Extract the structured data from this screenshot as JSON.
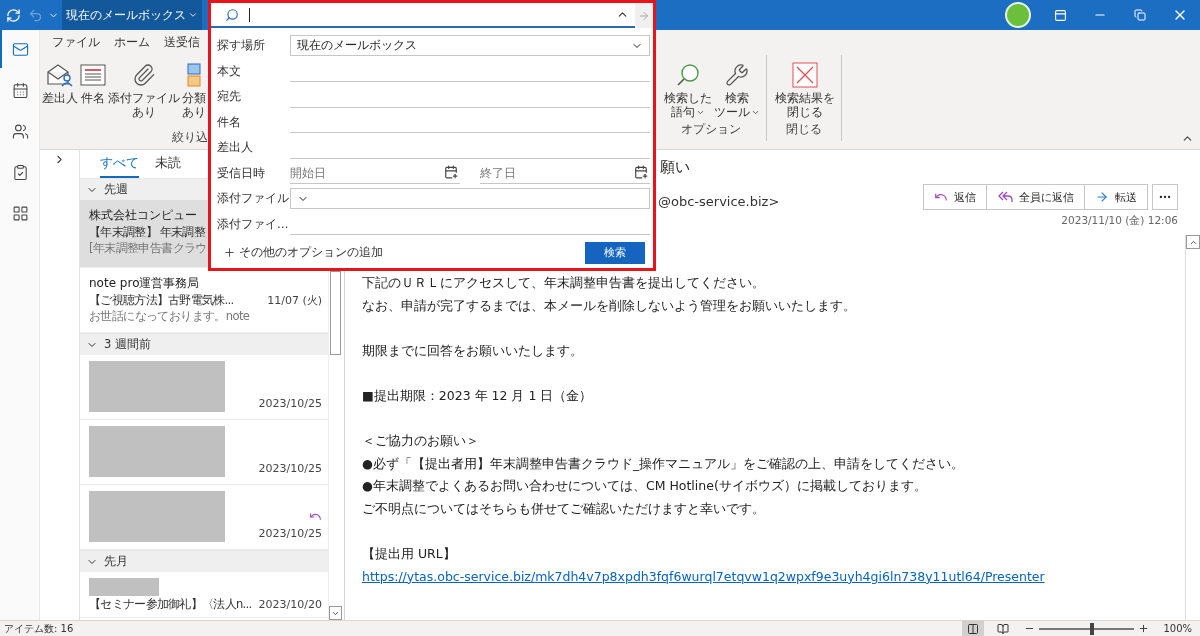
{
  "title_bar": {
    "undo": {
      "disabled": true
    },
    "mailbox_selector": "現在のメールボックス"
  },
  "nav_rail": [
    {
      "selected": true
    },
    {
      "selected": false
    },
    {
      "selected": false
    },
    {
      "selected": false
    },
    {
      "selected": false
    }
  ],
  "ribbon": {
    "tabs": [
      "ファイル",
      "ホーム",
      "送受信"
    ],
    "left_group": {
      "label": "絞り込",
      "buttons": [
        {
          "kind": "sender",
          "lines": [
            "差出人"
          ]
        },
        {
          "kind": "subject",
          "lines": [
            "件名"
          ]
        },
        {
          "kind": "attachment",
          "lines": [
            "添付ファイル",
            "あり"
          ]
        },
        {
          "kind": "category",
          "lines": [
            "分類",
            "あり"
          ]
        }
      ]
    },
    "right_groups": [
      {
        "label": "オプション",
        "buttons": [
          {
            "kind": "recent",
            "lines": [
              "検索した",
              "語句"
            ],
            "has_menu": true
          },
          {
            "kind": "tools",
            "lines": [
              "検索",
              "ツール"
            ],
            "has_menu": true
          }
        ]
      },
      {
        "label": "閉じる",
        "buttons": [
          {
            "kind": "close",
            "lines": [
              "検索結果を",
              "閉じる"
            ],
            "has_menu": false
          }
        ]
      }
    ]
  },
  "message_list": {
    "tabs": [
      {
        "label": "すべて",
        "selected": true
      },
      {
        "label": "未読",
        "selected": false
      }
    ],
    "groups": [
      {
        "label": "先週",
        "expanded": true,
        "items": [
          {
            "kind": "message",
            "selected": true,
            "replied": false,
            "sender": "株式会社コンピュー",
            "subject": "【年末調整】 年末調整",
            "preview": "[年末調整申告書クラウ"
          },
          {
            "kind": "message",
            "selected": false,
            "replied": false,
            "sender": "note pro運営事務局",
            "subject": "【ご視聴方法】古野電気株...",
            "date": "11/07 (火)",
            "preview": "お世話になっております。note"
          }
        ]
      },
      {
        "label": "3 週間前",
        "expanded": true,
        "items": [
          {
            "kind": "redacted",
            "selected": false,
            "replied": false,
            "date": "2023/10/25"
          },
          {
            "kind": "redacted",
            "selected": false,
            "replied": false,
            "date": "2023/10/25"
          },
          {
            "kind": "redacted",
            "selected": false,
            "replied": true,
            "date": "2023/10/25"
          }
        ]
      },
      {
        "label": "先月",
        "expanded": true,
        "items": [
          {
            "kind": "partly_redacted",
            "selected": false,
            "replied": false,
            "subject": "【セミナー参加御礼】〈法人n...",
            "date": "2023/10/20"
          }
        ]
      }
    ]
  },
  "reading_pane": {
    "subject": "願い",
    "sender": "@obc-service.biz>",
    "actions": [
      {
        "kind": "reply",
        "label": "返信"
      },
      {
        "kind": "reply_all",
        "label": "全員に返信"
      },
      {
        "kind": "forward",
        "label": "転送"
      }
    ],
    "date": "2023/11/10 (金) 12:06",
    "paragraphs": [
      {
        "lines": [
          "下記のＵＲＬにアクセスして、年末調整申告書を提出してください。",
          "なお、申請が完了するまでは、本メールを削除しないよう管理をお願いいたします。"
        ]
      },
      {
        "lines": [
          "期限までに回答をお願いいたします。"
        ]
      },
      {
        "lines": [
          "■提出期限：2023 年 12 月 1 日（金）"
        ]
      },
      {
        "lines": [
          "＜ご協力のお願い＞",
          "●必ず「【提出者用】年末調整申告書クラウド_操作マニュアル」をご確認の上、申請をしてください。",
          "●年末調整でよくあるお問い合わせについては、CM Hotline(サイボウズ）に掲載しております。",
          "ご不明点についてはそちらも併せてご確認いただけますと幸いです。"
        ]
      },
      {
        "lines": [
          "【提出用 URL】"
        ],
        "link": "https://ytas.obc-service.biz/mk7dh4v7p8xpdh3fqf6wurql7etqvw1q2wpxf9e3uyh4gi6ln738y11utl64/Presenter"
      }
    ]
  },
  "search_popup": {
    "go_disabled": true,
    "fields": [
      {
        "kind": "select",
        "label": "探す場所",
        "value": "現在のメールボックス"
      },
      {
        "kind": "text",
        "label": "本文"
      },
      {
        "kind": "text",
        "label": "宛先"
      },
      {
        "kind": "text",
        "label": "件名"
      },
      {
        "kind": "text",
        "label": "差出人"
      },
      {
        "kind": "date_range",
        "label": "受信日時",
        "from_placeholder": "開始日",
        "to_placeholder": "終了日"
      },
      {
        "kind": "select",
        "label": "添付ファイル"
      },
      {
        "kind": "text",
        "label": "添付ファイ…"
      }
    ],
    "add_options": "その他のオプションの追加",
    "search_button": "検索"
  },
  "status_bar": {
    "item_count": "アイテム数: 16",
    "views": [
      {
        "selected": true
      },
      {
        "selected": false
      }
    ],
    "zoom": {
      "level": 0.55,
      "reading": "100%"
    }
  }
}
